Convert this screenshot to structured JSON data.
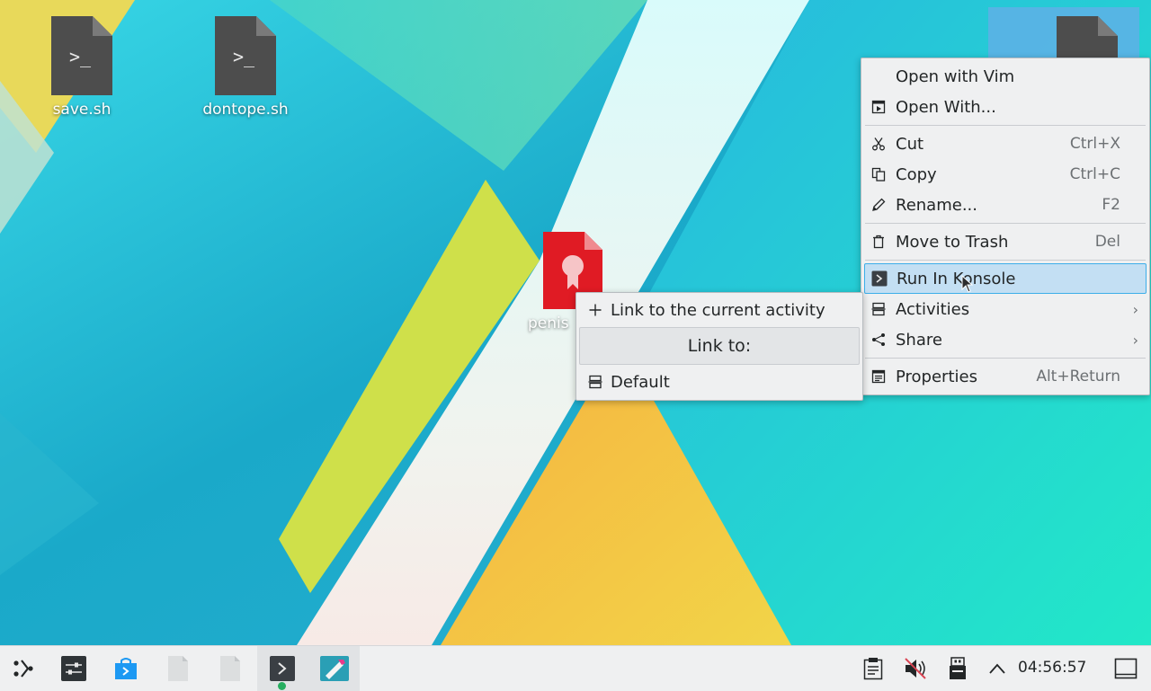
{
  "desktop": {
    "icons": [
      {
        "label": "save.sh",
        "type": "shell-script"
      },
      {
        "label": "dontope.sh",
        "type": "shell-script"
      },
      {
        "label": "penis",
        "type": "certificate-document"
      }
    ]
  },
  "context_menu": {
    "items": [
      {
        "label": "Open with Vim",
        "shortcut": "",
        "icon": "none"
      },
      {
        "label": "Open With...",
        "shortcut": "",
        "icon": "open-with-icon"
      },
      {
        "label": "Cut",
        "shortcut": "Ctrl+X",
        "icon": "scissors-icon"
      },
      {
        "label": "Copy",
        "shortcut": "Ctrl+C",
        "icon": "copy-icon"
      },
      {
        "label": "Rename...",
        "shortcut": "F2",
        "icon": "pencil-icon"
      },
      {
        "label": "Move to Trash",
        "shortcut": "Del",
        "icon": "trash-icon"
      },
      {
        "label": "Run In Konsole",
        "shortcut": "",
        "icon": "konsole-icon"
      },
      {
        "label": "Activities",
        "shortcut": "",
        "icon": "activities-icon"
      },
      {
        "label": "Share",
        "shortcut": "",
        "icon": "share-icon"
      },
      {
        "label": "Properties",
        "shortcut": "Alt+Return",
        "icon": "properties-icon"
      }
    ],
    "submenu_arrow": "›"
  },
  "activities_submenu": {
    "link_current": "Link to the current activity",
    "link_to_header": "Link to:",
    "default": "Default"
  },
  "taskbar": {
    "clock": "04:56:57",
    "tasks": [
      "system-settings",
      "discover",
      "blank-document",
      "blank-document",
      "konsole",
      "kate"
    ],
    "tray": [
      "clipboard-icon",
      "volume-muted-icon",
      "usb-storage-icon",
      "expand-tray-icon"
    ]
  },
  "colors": {
    "menu_bg": "#eff0f1",
    "highlight_bg": "#c3dff3",
    "highlight_border": "#3daee9",
    "pdf_red": "#e01b24"
  }
}
